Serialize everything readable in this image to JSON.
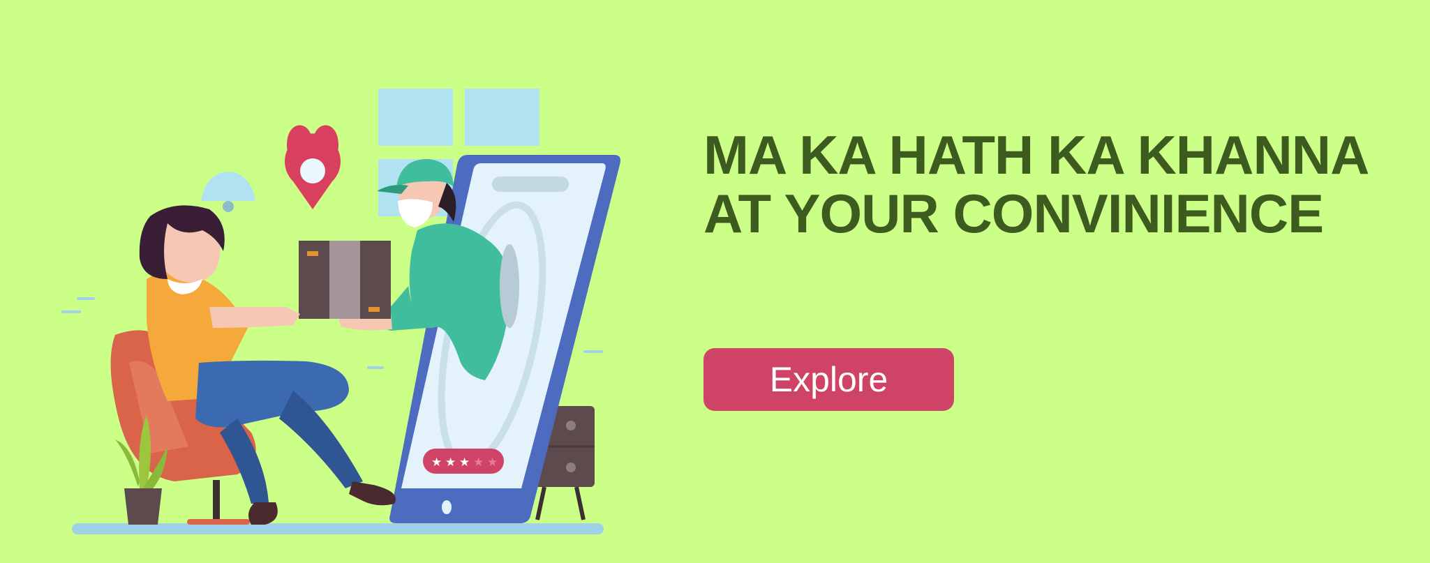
{
  "banner": {
    "headline_line1": "MA KA HATH KA KHANNA",
    "headline_line2": "AT YOUR CONVINIENCE",
    "explore_label": "Explore"
  },
  "illustration": {
    "description_icons": [
      "location-pin-icon",
      "ceiling-lamp-icon",
      "delivery-box-icon",
      "rating-stars-icon",
      "smartphone-icon",
      "potted-plant-icon",
      "armchair-icon"
    ],
    "rating_stars_filled": 3,
    "rating_stars_total": 5
  },
  "colors": {
    "background": "#cbff88",
    "headline": "#3d5a1f",
    "button": "#cf4366",
    "button_text": "#ffffff"
  }
}
